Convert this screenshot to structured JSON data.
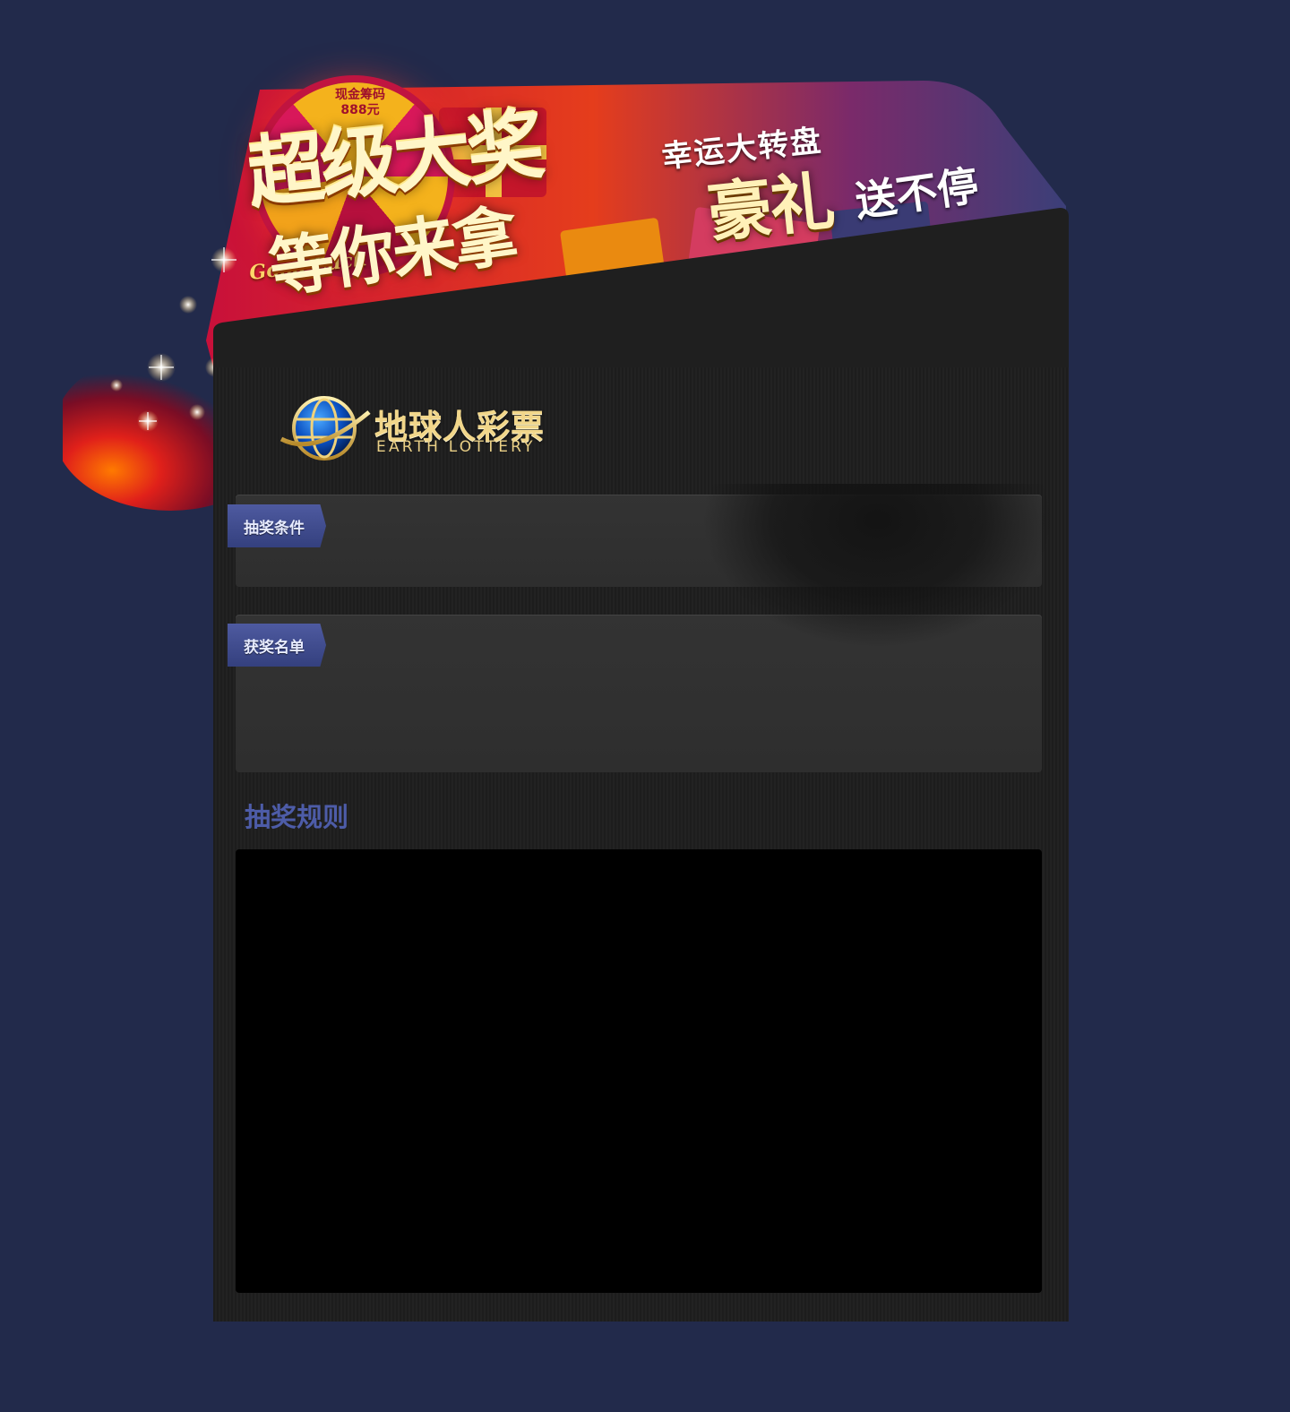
{
  "banner": {
    "wheel_prize_line1": "现金筹码",
    "wheel_prize_line2": "888元",
    "title_main": "超级大奖",
    "good_luck": "Good Luck",
    "title_sub": "等你来拿",
    "right_small": "幸运大转盘",
    "right_big": "豪礼",
    "right_end": "送不停"
  },
  "logo": {
    "name_cn": "地球人彩票",
    "name_en": "EARTH LOTTERY"
  },
  "sections": {
    "conditions_label": "抽奖条件",
    "winners_label": "获奖名单",
    "rules_title": "抽奖规则"
  },
  "colors": {
    "page_background": "#222a4b",
    "panel_background": "#1f1f1f",
    "tag_blue": "#3d4a8e",
    "rules_title_blue": "#4d5ca8",
    "logo_gold": "#f1d68a"
  }
}
